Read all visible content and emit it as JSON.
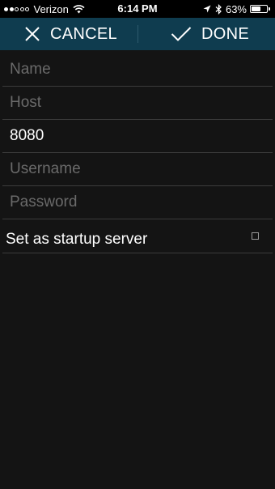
{
  "status_bar": {
    "carrier": "Verizon",
    "signal_bars_filled": 2,
    "signal_bars_total": 5,
    "time": "6:14 PM",
    "battery_percent": "63%",
    "battery_level": 0.63,
    "icons": [
      "wifi-icon",
      "location-arrow-icon",
      "bluetooth-icon",
      "battery-icon"
    ]
  },
  "toolbar": {
    "cancel_label": "CANCEL",
    "done_label": "DONE",
    "background": "#0f3c4f"
  },
  "form": {
    "name": {
      "value": "",
      "placeholder": "Name"
    },
    "host": {
      "value": "",
      "placeholder": "Host"
    },
    "port": {
      "value": "8080",
      "placeholder": ""
    },
    "username": {
      "value": "",
      "placeholder": "Username"
    },
    "password": {
      "value": "",
      "placeholder": "Password"
    },
    "startup": {
      "label": "Set as startup server",
      "checked": false
    }
  }
}
